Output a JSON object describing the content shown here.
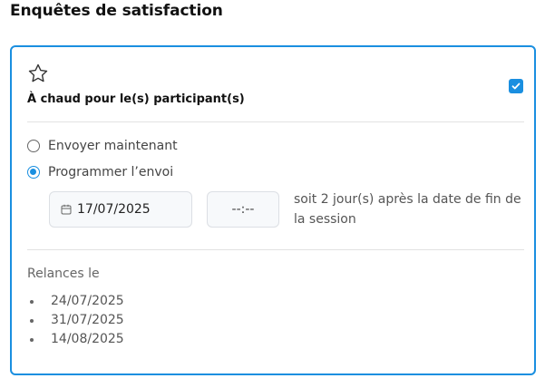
{
  "page": {
    "title": "Enquêtes de satisfaction"
  },
  "card": {
    "title": "À chaud pour le(s) participant(s)",
    "enabled": true,
    "options": [
      {
        "label": "Envoyer maintenant",
        "selected": false
      },
      {
        "label": "Programmer l’envoi",
        "selected": true
      }
    ],
    "schedule": {
      "date": "17/07/2025",
      "time_placeholder": "--:--",
      "offset_text": "soit 2 jour(s) après la date de fin de la session"
    },
    "relances": {
      "label": "Relances le",
      "dates": [
        "24/07/2025",
        "31/07/2025",
        "14/08/2025"
      ]
    }
  },
  "colors": {
    "accent": "#1a8fe0"
  }
}
